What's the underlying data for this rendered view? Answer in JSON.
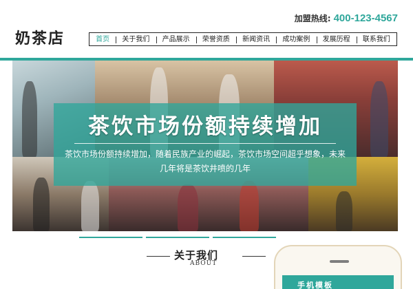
{
  "header": {
    "logo": "奶茶店",
    "hotline_label": "加盟热线:",
    "hotline_number": "400-123-4567"
  },
  "nav": {
    "items": [
      {
        "label": "首页",
        "active": true
      },
      {
        "label": "关于我们"
      },
      {
        "label": "产品展示"
      },
      {
        "label": "荣誉资质"
      },
      {
        "label": "新闻资讯"
      },
      {
        "label": "成功案例"
      },
      {
        "label": "发展历程"
      },
      {
        "label": "联系我们"
      }
    ]
  },
  "banner": {
    "headline": "茶饮市场份额持续增加",
    "subtext": "茶饮市场份额持续增加，随着民族产业的崛起，茶饮市场空间超乎想象，未来几年将是茶饮井喷的几年"
  },
  "about": {
    "title": "关于我们",
    "subtitle": "ABOUT"
  },
  "phone": {
    "label": "手机模板"
  },
  "colors": {
    "accent": "#2fa79b",
    "text": "#222222"
  }
}
